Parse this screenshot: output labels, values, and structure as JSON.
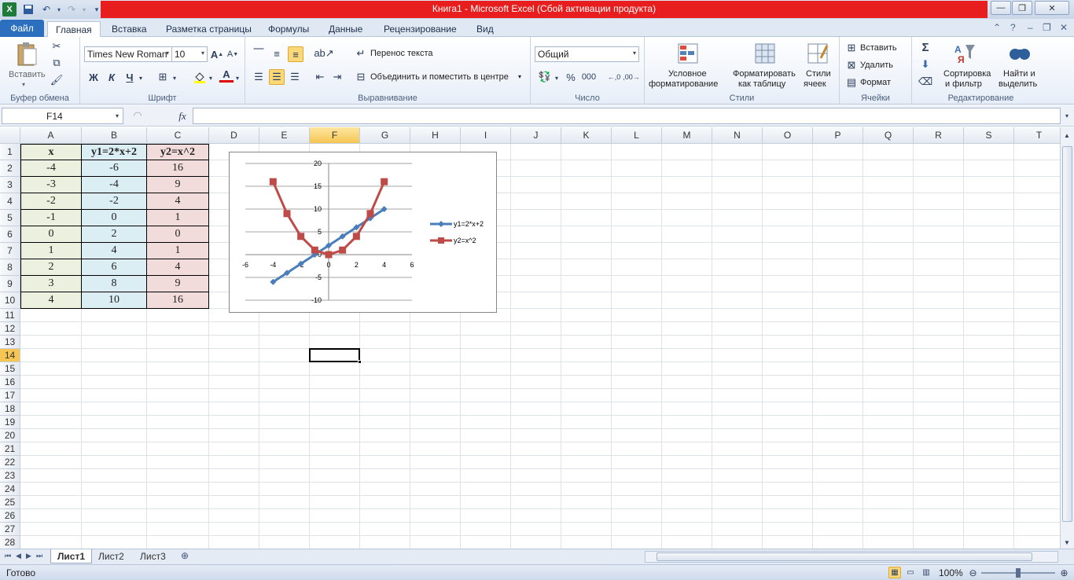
{
  "window": {
    "title": "Книга1  -  Microsoft Excel (Сбой активации продукта)",
    "app_icon": "X"
  },
  "ribbon_tabs": [
    {
      "label": "Файл"
    },
    {
      "label": "Главная"
    },
    {
      "label": "Вставка"
    },
    {
      "label": "Разметка страницы"
    },
    {
      "label": "Формулы"
    },
    {
      "label": "Данные"
    },
    {
      "label": "Рецензирование"
    },
    {
      "label": "Вид"
    }
  ],
  "ribbon": {
    "clipboard": {
      "paste": "Вставить",
      "group": "Буфер обмена"
    },
    "font": {
      "name": "Times New Roman",
      "size": "10",
      "bold": "Ж",
      "italic": "К",
      "underline": "Ч",
      "group": "Шрифт"
    },
    "alignment": {
      "wrap": "Перенос текста",
      "merge": "Объединить и поместить в центре",
      "group": "Выравнивание"
    },
    "number": {
      "format": "Общий",
      "percent": "%",
      "thousands": "000",
      "group": "Число"
    },
    "styles": {
      "conditional_1": "Условное",
      "conditional_2": "форматирование",
      "table_1": "Форматировать",
      "table_2": "как таблицу",
      "cell_1": "Стили",
      "cell_2": "ячеек",
      "group": "Стили"
    },
    "cells": {
      "insert": "Вставить",
      "delete": "Удалить",
      "format": "Формат",
      "group": "Ячейки"
    },
    "editing": {
      "sort_1": "Сортировка",
      "sort_2": "и фильтр",
      "find_1": "Найти и",
      "find_2": "выделить",
      "group": "Редактирование"
    }
  },
  "formula_bar": {
    "name_box": "F14",
    "fx": "fx",
    "formula": ""
  },
  "columns": [
    "A",
    "B",
    "C",
    "D",
    "E",
    "F",
    "G",
    "H",
    "I",
    "J",
    "K",
    "L",
    "M",
    "N",
    "O",
    "P",
    "Q",
    "R",
    "S",
    "T"
  ],
  "selected_column": "F",
  "rows": [
    "1",
    "2",
    "3",
    "4",
    "5",
    "6",
    "7",
    "8",
    "9",
    "10",
    "11",
    "12",
    "13",
    "14",
    "15",
    "16",
    "17",
    "18",
    "19",
    "20",
    "21",
    "22",
    "23",
    "24",
    "25",
    "26",
    "27",
    "28"
  ],
  "selected_row": "14",
  "table": {
    "headers": [
      "x",
      "y1=2*x+2",
      "y2=x^2"
    ],
    "rows": [
      [
        "-4",
        "-6",
        "16"
      ],
      [
        "-3",
        "-4",
        "9"
      ],
      [
        "-2",
        "-2",
        "4"
      ],
      [
        "-1",
        "0",
        "1"
      ],
      [
        "0",
        "2",
        "0"
      ],
      [
        "1",
        "4",
        "1"
      ],
      [
        "2",
        "6",
        "4"
      ],
      [
        "3",
        "8",
        "9"
      ],
      [
        "4",
        "10",
        "16"
      ]
    ]
  },
  "chart_data": {
    "type": "line",
    "title": "",
    "x": [
      -4,
      -3,
      -2,
      -1,
      0,
      1,
      2,
      3,
      4
    ],
    "series": [
      {
        "name": "y1=2*x+2",
        "values": [
          -6,
          -4,
          -2,
          0,
          2,
          4,
          6,
          8,
          10
        ],
        "color": "#4a7ebb",
        "marker": "diamond"
      },
      {
        "name": "y2=x^2",
        "values": [
          16,
          9,
          4,
          1,
          0,
          1,
          4,
          9,
          16
        ],
        "color": "#be4b48",
        "marker": "square"
      }
    ],
    "xlim": [
      -6,
      6
    ],
    "ylim": [
      -10,
      20
    ],
    "xticks": [
      "-6",
      "-4",
      "-2",
      "0",
      "2",
      "4",
      "6"
    ],
    "yticks": [
      "-10",
      "-5",
      "0",
      "5",
      "10",
      "15",
      "20"
    ],
    "grid": true,
    "legend": "right"
  },
  "sheets": [
    {
      "label": "Лист1"
    },
    {
      "label": "Лист2"
    },
    {
      "label": "Лист3"
    }
  ],
  "status": {
    "ready": "Готово",
    "zoom": "100%"
  }
}
